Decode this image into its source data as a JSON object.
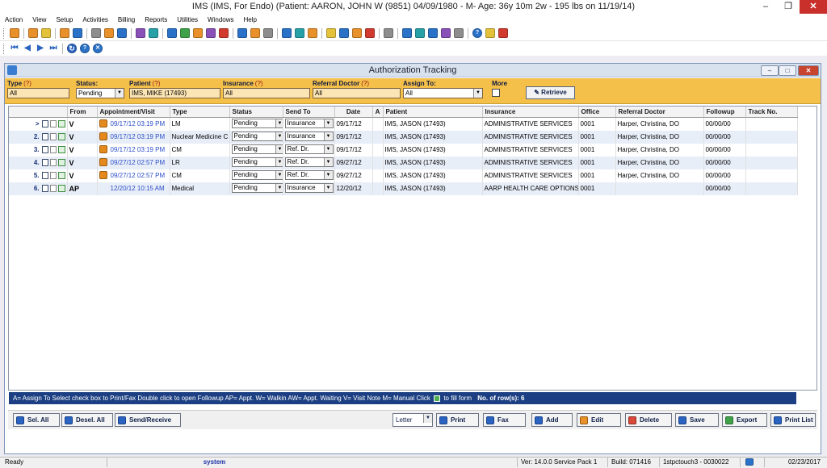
{
  "window": {
    "title": "IMS (IMS, For Endo)    (Patient: AARON, JOHN W (9851) 04/09/1980 - M- Age: 36y 10m 2w - 195 lbs on 11/19/14)"
  },
  "menu": [
    "Action",
    "View",
    "Setup",
    "Activities",
    "Billing",
    "Reports",
    "Utilities",
    "Windows",
    "Help"
  ],
  "child_window": {
    "title": "Authorization Tracking"
  },
  "filters": {
    "type_label": "Type",
    "status_label": "Status:",
    "patient_label": "Patient",
    "insurance_label": "Insurance",
    "referral_label": "Referral Doctor",
    "assign_label": "Assign To:",
    "more_label": "More",
    "help_mark": "(?)",
    "type_value": "All",
    "status_value": "Pending",
    "patient_value": "IMS, MIKE  (17493)",
    "insurance_value": "All",
    "referral_value": "All",
    "assign_value": "All",
    "retrieve_label": "Retrieve"
  },
  "grid": {
    "columns": [
      "From",
      "Appointment/Visit",
      "Type",
      "Status",
      "Send To",
      "Date",
      "A",
      "Patient",
      "Insurance",
      "Office",
      "Referral Doctor",
      "Followup",
      "Track No."
    ],
    "rows": [
      {
        "num": ">",
        "from": "V",
        "appt": "09/17/12 03:19 PM",
        "type": "LM",
        "status": "Pending",
        "send_to": "Insurance",
        "date": "09/17/12",
        "a": "",
        "patient": "IMS, JASON  (17493)",
        "insurance": "ADMINISTRATIVE SERVICES",
        "office": "0001",
        "referral": "Harper, Christina, DO",
        "followup": "00/00/00",
        "track": ""
      },
      {
        "num": "2.",
        "from": "V",
        "appt": "09/17/12 03:19 PM",
        "type": "Nuclear Medicine C",
        "status": "Pending",
        "send_to": "Insurance",
        "date": "09/17/12",
        "a": "",
        "patient": "IMS, JASON  (17493)",
        "insurance": "ADMINISTRATIVE SERVICES",
        "office": "0001",
        "referral": "Harper, Christina, DO",
        "followup": "00/00/00",
        "track": ""
      },
      {
        "num": "3.",
        "from": "V",
        "appt": "09/17/12 03:19 PM",
        "type": "CM",
        "status": "Pending",
        "send_to": "Ref. Dr.",
        "date": "09/17/12",
        "a": "",
        "patient": "IMS, JASON  (17493)",
        "insurance": "ADMINISTRATIVE SERVICES",
        "office": "0001",
        "referral": "Harper, Christina, DO",
        "followup": "00/00/00",
        "track": ""
      },
      {
        "num": "4.",
        "from": "V",
        "appt": "09/27/12 02:57 PM",
        "type": "LR",
        "status": "Pending",
        "send_to": "Ref. Dr.",
        "date": "09/27/12",
        "a": "",
        "patient": "IMS, JASON  (17493)",
        "insurance": "ADMINISTRATIVE SERVICES",
        "office": "0001",
        "referral": "Harper, Christina, DO",
        "followup": "00/00/00",
        "track": ""
      },
      {
        "num": "5.",
        "from": "V",
        "appt": "09/27/12 02:57 PM",
        "type": "CM",
        "status": "Pending",
        "send_to": "Ref. Dr.",
        "date": "09/27/12",
        "a": "",
        "patient": "IMS, JASON  (17493)",
        "insurance": "ADMINISTRATIVE SERVICES",
        "office": "0001",
        "referral": "Harper, Christina, DO",
        "followup": "00/00/00",
        "track": ""
      },
      {
        "num": "6.",
        "from": "AP",
        "appt": "12/20/12 10:15 AM",
        "type": "Medical",
        "status": "Pending",
        "send_to": "Insurance",
        "date": "12/20/12",
        "a": "",
        "patient": "IMS, JASON  (17493)",
        "insurance": "AARP HEALTH CARE OPTIONS",
        "office": "0001",
        "referral": "",
        "followup": "00/00/00",
        "track": ""
      }
    ]
  },
  "legend": {
    "text": "A= Assign To   Select check box to Print/Fax    Double click to open Followup    AP= Appt. W= Walkin  AW= Appt. Waiting  V= Visit Note  M= Manual    Click",
    "text_after": "to fill form",
    "rows_label": "No. of row(s): 6"
  },
  "buttons": {
    "sel_all": "Sel. All",
    "desel_all": "Desel. All",
    "send_receive": "Send/Receive",
    "paper": "Letter",
    "print": "Print",
    "fax": "Fax",
    "add": "Add",
    "edit": "Edit",
    "delete": "Delete",
    "save": "Save",
    "export": "Export",
    "print_list": "Print List"
  },
  "status_bar": {
    "ready": "Ready",
    "user": "system",
    "version": "Ver: 14.0.0 Service Pack 1",
    "build": "Build: 071416",
    "server": "1stpctouch3 - 0030022",
    "date": "02/23/2017"
  }
}
